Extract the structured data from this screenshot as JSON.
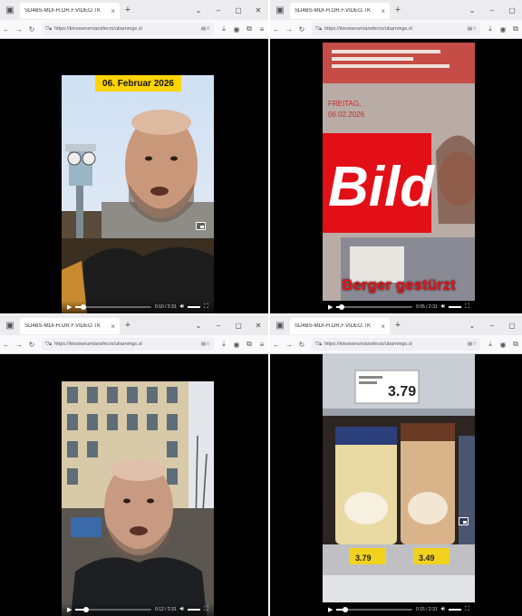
{
  "windows": [
    {
      "tab_title": "SD4BS-MDI-H.OR.F.VIDEO.TK",
      "url": "https://kinoswrum/ansfecrs/ubarnmgs.sl",
      "overlay": "06. Februar 2026",
      "time": "0:10 / 2:31"
    },
    {
      "tab_title": "SD4BS-MDI-H.OR.F.VIDEO.TK",
      "url": "https://kinoswrum/ansfecrs/ubarnmgs.sl",
      "newspaper_line1": "FREITAG,",
      "newspaper_line2": "06.02.2026",
      "newspaper_logo": "Bild",
      "overlay": "Berger gestürzt",
      "time": "0:05 / 2:31"
    },
    {
      "tab_title": "SD4BS-MDI-H.OR.F.VIDEO.TK",
      "url": "https://kinoswrum/ansfecrs/ubarnmgs.sl",
      "time": "0:12 / 2:31"
    },
    {
      "tab_title": "SD4BS-MDI-H.OR.F.VIDEO.TK",
      "url": "https://kinoswrum/ansfecrs/ubarnmgs.sl",
      "price_tag": "3.79",
      "shelf_price_1": "3.79",
      "shelf_price_2": "3.49",
      "time": "0:15 / 2:31"
    }
  ],
  "progress": [
    0.1,
    0.07,
    0.14,
    0.12
  ],
  "colors": {
    "overlay_yellow": "#ffd400",
    "overlay_red": "#e8141a",
    "tabbar": "#ececef"
  }
}
